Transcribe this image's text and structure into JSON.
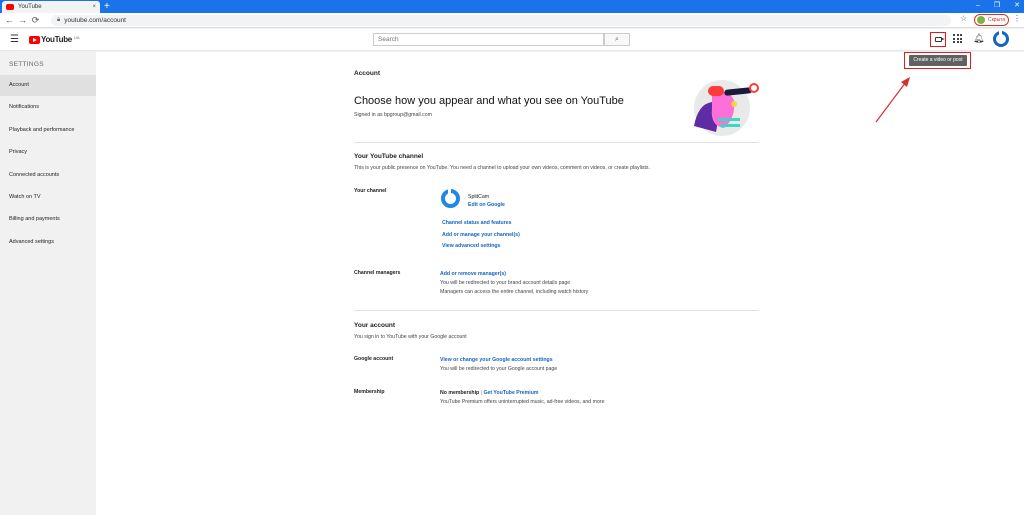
{
  "browser": {
    "tab_title": "YouTube",
    "tab_close": "×",
    "new_tab": "+",
    "window_min": "–",
    "window_max": "❐",
    "window_close": "✕",
    "back": "←",
    "forward": "→",
    "reload": "⟳",
    "url": "youtube.com/account",
    "star": "☆",
    "profile_label": "Скрыта",
    "menu": "⋮"
  },
  "masthead": {
    "logo_text": "YouTube",
    "logo_sup": "UA",
    "search_placeholder": "Search",
    "search_icon": "🔍",
    "tooltip": "Create a video or post"
  },
  "sidebar": {
    "heading": "SETTINGS",
    "items": [
      {
        "label": "Account",
        "active": true
      },
      {
        "label": "Notifications"
      },
      {
        "label": "Playback and performance"
      },
      {
        "label": "Privacy"
      },
      {
        "label": "Connected accounts"
      },
      {
        "label": "Watch on TV"
      },
      {
        "label": "Billing and payments"
      },
      {
        "label": "Advanced settings"
      }
    ]
  },
  "main": {
    "section_label": "Account",
    "headline": "Choose how you appear and what you see on YouTube",
    "signed_in": "Signed in as bpgroup@gmail.com",
    "channel_section": {
      "title": "Your YouTube channel",
      "desc": "This is your public presence on YouTube. You need a channel to upload your own videos, comment on videos, or create playlists.",
      "your_channel_label": "Your channel",
      "channel_name": "SplitCam",
      "edit_link": "Edit on Google",
      "links": [
        "Channel status and features",
        "Add or manage your channel(s)",
        "View advanced settings"
      ],
      "managers_label": "Channel managers",
      "managers_link": "Add or remove manager(s)",
      "managers_note1": "You will be redirected to your brand account details page",
      "managers_note2": "Managers can access the entire channel, including watch history"
    },
    "account_section": {
      "title": "Your account",
      "desc": "You sign in to YouTube with your Google account",
      "google_label": "Google account",
      "google_link": "View or change your Google account settings",
      "google_note": "You will be redirected to your Google account page",
      "membership_label": "Membership",
      "membership_value": "No membership",
      "membership_sep": " | ",
      "membership_link": "Get YouTube Premium",
      "membership_note": "YouTube Premium offers uninterrupted music, ad-free videos, and more"
    }
  },
  "colors": {
    "chrome_blue": "#1a73e8",
    "yt_red": "#ff0000",
    "link_blue": "#1565c0",
    "highlight_red": "#e31c1c"
  }
}
